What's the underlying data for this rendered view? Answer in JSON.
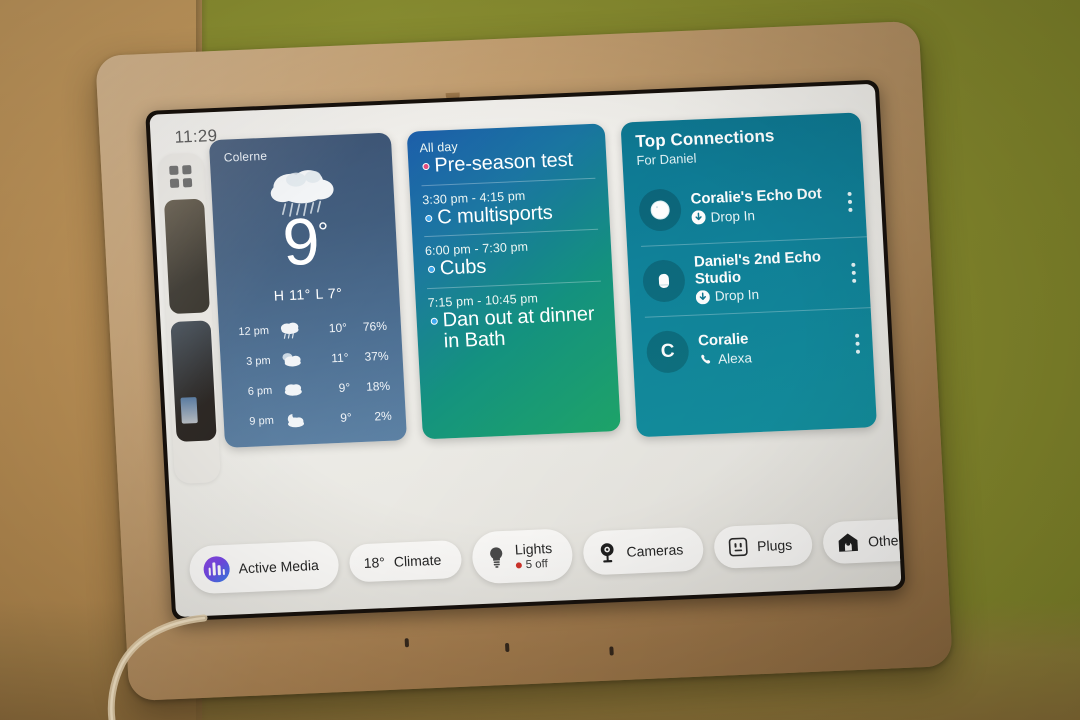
{
  "device": {
    "clock": "11:29"
  },
  "sidebar": {
    "grid_icon": "apps-grid-icon",
    "photo_cards": 2
  },
  "weather": {
    "location": "Colerne",
    "condition_icon": "rain-cloud-icon",
    "temperature": "9",
    "degree": "°",
    "high_low": "H 11°  L 7°",
    "hourly": [
      {
        "time": "12 pm",
        "icon": "rain-icon",
        "temp": "10°",
        "precip": "76%"
      },
      {
        "time": "3 pm",
        "icon": "partly-cloudy-icon",
        "temp": "11°",
        "precip": "37%"
      },
      {
        "time": "6 pm",
        "icon": "cloudy-icon",
        "temp": "9°",
        "precip": "18%"
      },
      {
        "time": "9 pm",
        "icon": "night-cloudy-icon",
        "temp": "9°",
        "precip": "2%"
      }
    ]
  },
  "calendar": {
    "events": [
      {
        "when": "All day",
        "title": "Pre-season test",
        "dot_color": "#e0467a"
      },
      {
        "when": "3:30 pm - 4:15 pm",
        "title": "C multisports",
        "dot_color": "#3aa6ef"
      },
      {
        "when": "6:00 pm - 7:30 pm",
        "title": "Cubs",
        "dot_color": "#3aa6ef"
      },
      {
        "when": "7:15 pm - 10:45 pm",
        "title": "Dan out at dinner in Bath",
        "dot_color": "#3aa6ef"
      }
    ]
  },
  "connections": {
    "title": "Top Connections",
    "subtitle": "For Daniel",
    "items": [
      {
        "avatar": "echo-dot-icon",
        "initial": "",
        "name": "Coralie's Echo Dot",
        "action": "Drop In",
        "action_icon": "drop-in-icon",
        "menu_icon": "kebab-menu-icon"
      },
      {
        "avatar": "echo-studio-icon",
        "initial": "",
        "name": "Daniel's 2nd Echo Studio",
        "action": "Drop In",
        "action_icon": "drop-in-icon",
        "menu_icon": "kebab-menu-icon"
      },
      {
        "avatar": "letter-avatar",
        "initial": "C",
        "name": "Coralie",
        "action": "Alexa",
        "action_icon": "phone-icon",
        "menu_icon": "kebab-menu-icon"
      }
    ]
  },
  "chips": [
    {
      "label": "Active Media",
      "sub": "",
      "value": "",
      "icon": "media-equalizer-icon"
    },
    {
      "label": "Climate",
      "sub": "",
      "value": "18°",
      "icon": "temperature-value"
    },
    {
      "label": "Lights",
      "sub": "5 off",
      "value": "",
      "icon": "light-bulb-icon"
    },
    {
      "label": "Cameras",
      "sub": "",
      "value": "",
      "icon": "camera-icon"
    },
    {
      "label": "Plugs",
      "sub": "",
      "value": "",
      "icon": "power-outlet-icon"
    },
    {
      "label": "Other",
      "sub": "",
      "value": "",
      "icon": "home-icon"
    }
  ],
  "colors": {
    "weather_card": "#3a5779",
    "calendar_card_start": "#1257a6",
    "calendar_card_end": "#1ea66a",
    "connections_card": "#10829a",
    "wall": "#8c9030",
    "mount_frame": "#c6a172",
    "alert_red": "#d0342c"
  }
}
